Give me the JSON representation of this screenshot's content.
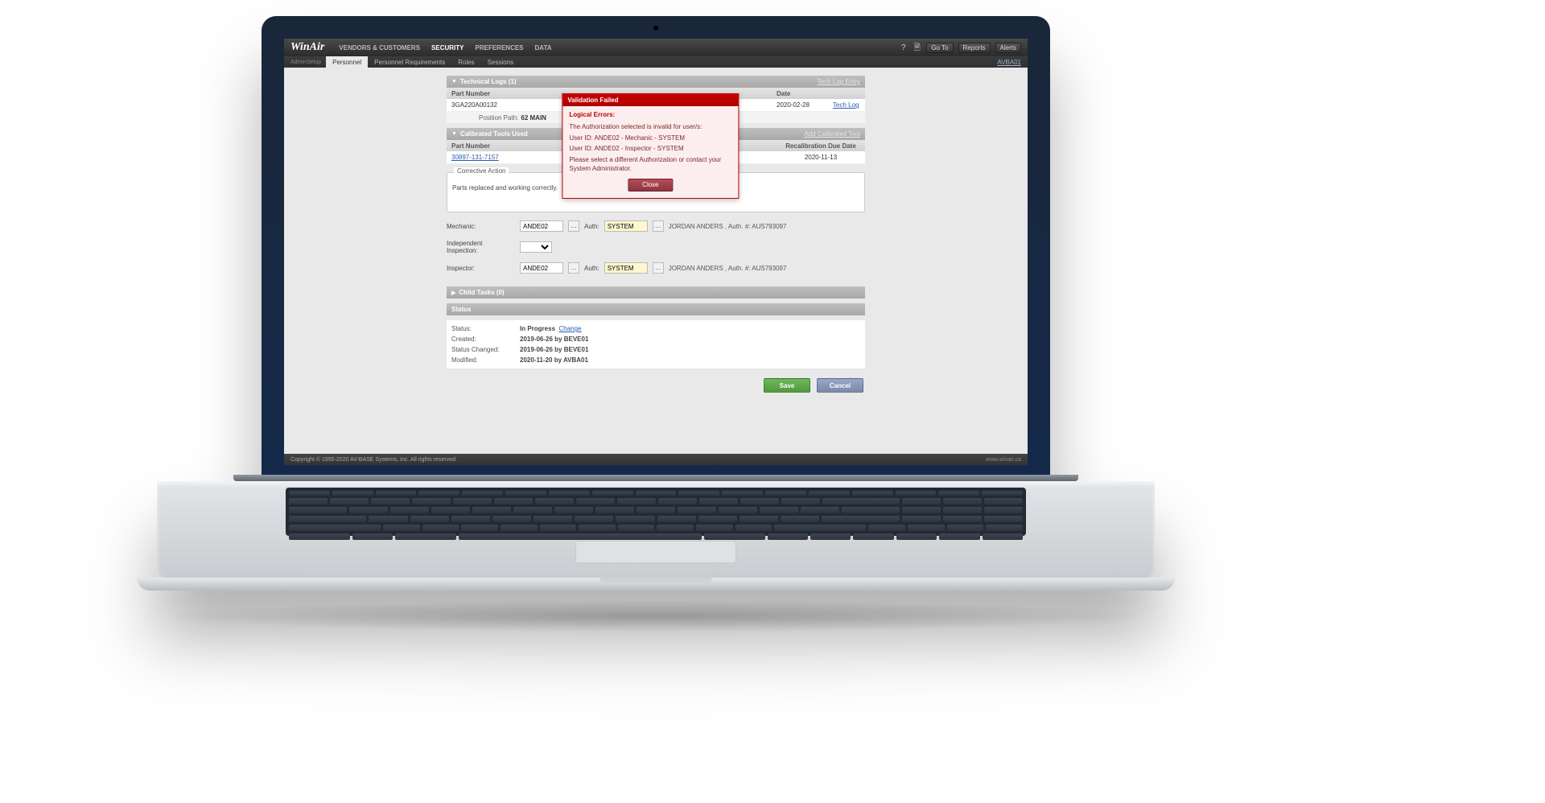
{
  "brand": "WinAir",
  "top_nav": {
    "items": [
      "VENDORS & CUSTOMERS",
      "SECURITY",
      "PREFERENCES",
      "DATA"
    ],
    "active_index": 1,
    "right_buttons": [
      "Go To",
      "Reports",
      "Alerts"
    ],
    "help_glyph": "?",
    "doc_glyph": "🗎"
  },
  "sub_nav": {
    "module": "AdminSetup",
    "tabs": [
      "Personnel",
      "Personnel Requirements",
      "Roles",
      "Sessions"
    ],
    "active_index": 0,
    "user_code": "AVBA01"
  },
  "panels": {
    "tech_logs": {
      "title": "Technical Logs (1)",
      "action": "Tech Log Entry",
      "cols": [
        "Part Number",
        "",
        "Date",
        ""
      ],
      "row": {
        "part": "3GA220A00132",
        "date": "2020-02-28",
        "link": "Tech Log"
      },
      "position_path": {
        "label": "Position Path:",
        "value": "62 MAIN"
      }
    },
    "cal_tools": {
      "title": "Calibrated Tools Used",
      "action": "Add Calibrated Tool",
      "cols": [
        "Part Number",
        "",
        "Recalibration Due Date"
      ],
      "row": {
        "part": "30897-131-7157",
        "due": "2020-11-13"
      }
    },
    "corrective": {
      "legend": "Corrective Action",
      "text": "Parts replaced and working correctly."
    },
    "signoff": {
      "mechanic_label": "Mechanic:",
      "inspector_label": "Inspector:",
      "indep_label": "Independent Inspection:",
      "auth_label": "Auth:",
      "mechanic_id": "ANDE02",
      "inspector_id": "ANDE02",
      "auth_value": "SYSTEM",
      "readout": "JORDAN ANDERS ,  Auth. #: AUS793097",
      "lookup_glyph": "…"
    },
    "child_tasks": {
      "title": "Child Tasks (0)"
    },
    "status": {
      "title": "Status",
      "rows": {
        "status_k": "Status:",
        "status_v": "In Progress",
        "status_change": "Change",
        "created_k": "Created:",
        "created_v": "2019-06-26 by BEVE01",
        "changed_k": "Status Changed:",
        "changed_v": "2019-06-26 by BEVE01",
        "modified_k": "Modified:",
        "modified_v": "2020-11-20 by AVBA01"
      }
    },
    "buttons": {
      "save": "Save",
      "cancel": "Cancel"
    }
  },
  "dialog": {
    "title": "Validation Failed",
    "heading": "Logical Errors:",
    "line1": "The Authorization selected is invalid for user/s:",
    "line2": "User ID: ANDE02 - Mechanic - SYSTEM",
    "line3": "User ID: ANDE02 - Inspector - SYSTEM",
    "line4": "Please select a different Authorization or contact your System Administrator.",
    "close": "Close"
  },
  "footer": {
    "left": "Copyright © 1995-2020 AV-BASE Systems, Inc. All rights reserved.",
    "right": "www.winair.ca"
  }
}
